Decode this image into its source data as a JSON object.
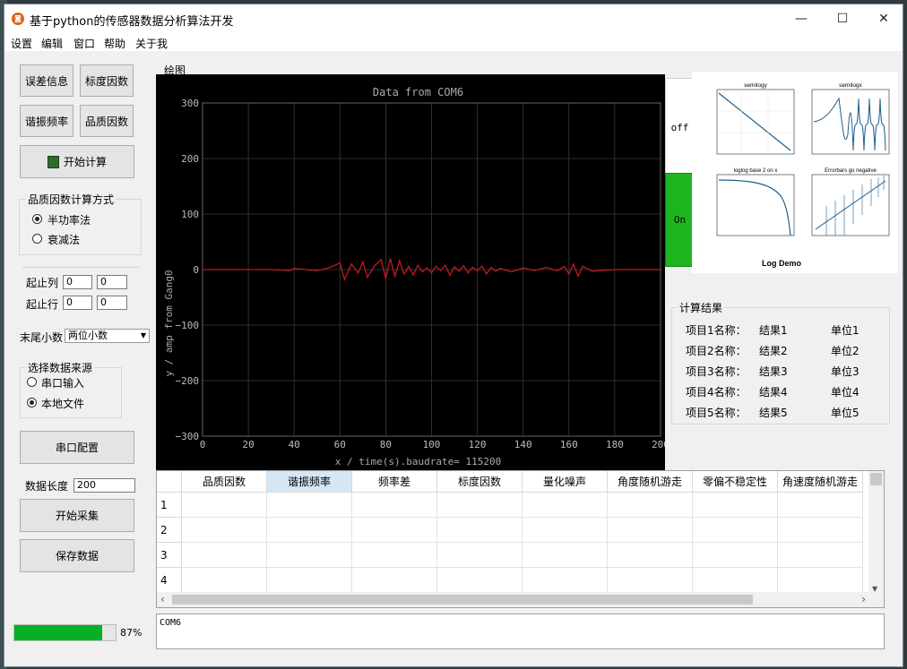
{
  "window": {
    "title": "基于python的传感器数据分析算法开发",
    "min_glyph": "—",
    "max_glyph": "☐",
    "close_glyph": "✕"
  },
  "menu": [
    "设置",
    "编辑",
    "窗口",
    "帮助",
    "关于我"
  ],
  "left_panel": {
    "buttons": {
      "error_info": "误差信息",
      "scale_factor": "标度因数",
      "resonant_freq": "谐振频率",
      "quality_factor": "品质因数",
      "start_calc": "开始计算",
      "serial_config": "串口配置",
      "start_collect": "开始采集",
      "save_data": "保存数据"
    },
    "calc_method": {
      "title": "品质因数计算方式",
      "options": [
        {
          "label": "半功率法",
          "selected": true
        },
        {
          "label": "衰减法",
          "selected": false
        }
      ]
    },
    "range": {
      "col_label": "起止列",
      "row_label": "起止行",
      "col_start": "0",
      "col_end": "0",
      "row_start": "0",
      "row_end": "0"
    },
    "decimals": {
      "label": "末尾小数",
      "value": "两位小数"
    },
    "source": {
      "title": "选择数据来源",
      "options": [
        {
          "label": "串口输入",
          "selected": false
        },
        {
          "label": "本地文件",
          "selected": true
        }
      ]
    },
    "data_length": {
      "label": "数据长度",
      "value": "200"
    },
    "progress": {
      "value": 0.87,
      "text": "87%"
    }
  },
  "plot_section": {
    "frame_label": "绘图",
    "toggle_off": "off",
    "toggle_on": "On",
    "thumbnail_title": "Log Demo",
    "thumbnail_subplots": [
      "semilogy",
      "semilogx",
      "loglog base 2 on x",
      "Errorbars go negative"
    ],
    "colors": {
      "plot_bg": "#000000",
      "grid": "#3a3a3a",
      "trace": "#c21a1a",
      "on_green": "#1db51d"
    }
  },
  "chart_data": {
    "type": "line",
    "title": "Data from COM6",
    "xlabel": "x / time(s).baudrate= 115200",
    "ylabel": "y / amp from Gang0",
    "xlim": [
      0,
      200
    ],
    "ylim": [
      -300,
      300
    ],
    "xticks": [
      "0",
      "20",
      "40",
      "60",
      "80",
      "100",
      "120",
      "140",
      "160",
      "180",
      "200"
    ],
    "yticks": [
      "300",
      "200",
      "100",
      "0",
      "−100",
      "−200",
      "−300"
    ],
    "grid": true,
    "series": [
      {
        "x": [
          0,
          10,
          20,
          30,
          38,
          40,
          45,
          50,
          55,
          58,
          60,
          62,
          65,
          68,
          70,
          72,
          75,
          78,
          80,
          82,
          84,
          86,
          88,
          90,
          92,
          94,
          96,
          98,
          100,
          102,
          104,
          106,
          108,
          110,
          112,
          114,
          116,
          118,
          120,
          122,
          124,
          126,
          128,
          130,
          135,
          140,
          145,
          150,
          155,
          158,
          160,
          162,
          164,
          166,
          170,
          180,
          190,
          200
        ],
        "y": [
          0,
          0,
          0,
          0,
          -2,
          2,
          0,
          -2,
          3,
          8,
          12,
          -18,
          10,
          -6,
          14,
          -14,
          6,
          18,
          -16,
          20,
          -12,
          16,
          -8,
          6,
          -10,
          8,
          -4,
          3,
          -6,
          6,
          -2,
          8,
          -10,
          5,
          -3,
          7,
          -6,
          4,
          -2,
          6,
          -8,
          4,
          -3,
          2,
          -4,
          3,
          -2,
          4,
          -2,
          6,
          -8,
          10,
          -12,
          6,
          -3,
          0,
          0,
          0
        ]
      }
    ]
  },
  "results": {
    "title": "计算结果",
    "rows": [
      {
        "name": "项目1名称：",
        "value": "结果1",
        "unit": "单位1"
      },
      {
        "name": "项目2名称：",
        "value": "结果2",
        "unit": "单位2"
      },
      {
        "name": "项目3名称：",
        "value": "结果3",
        "unit": "单位3"
      },
      {
        "name": "项目4名称：",
        "value": "结果4",
        "unit": "单位4"
      },
      {
        "name": "项目5名称：",
        "value": "结果5",
        "unit": "单位5"
      }
    ]
  },
  "table": {
    "columns": [
      "品质因数",
      "谐振频率",
      "频率差",
      "标度因数",
      "量化噪声",
      "角度随机游走",
      "零偏不稳定性",
      "角速度随机游走"
    ],
    "rows": [
      "1",
      "2",
      "3",
      "4"
    ],
    "scroll_left": "‹",
    "scroll_right": "›"
  },
  "console": {
    "text": "COM6"
  }
}
